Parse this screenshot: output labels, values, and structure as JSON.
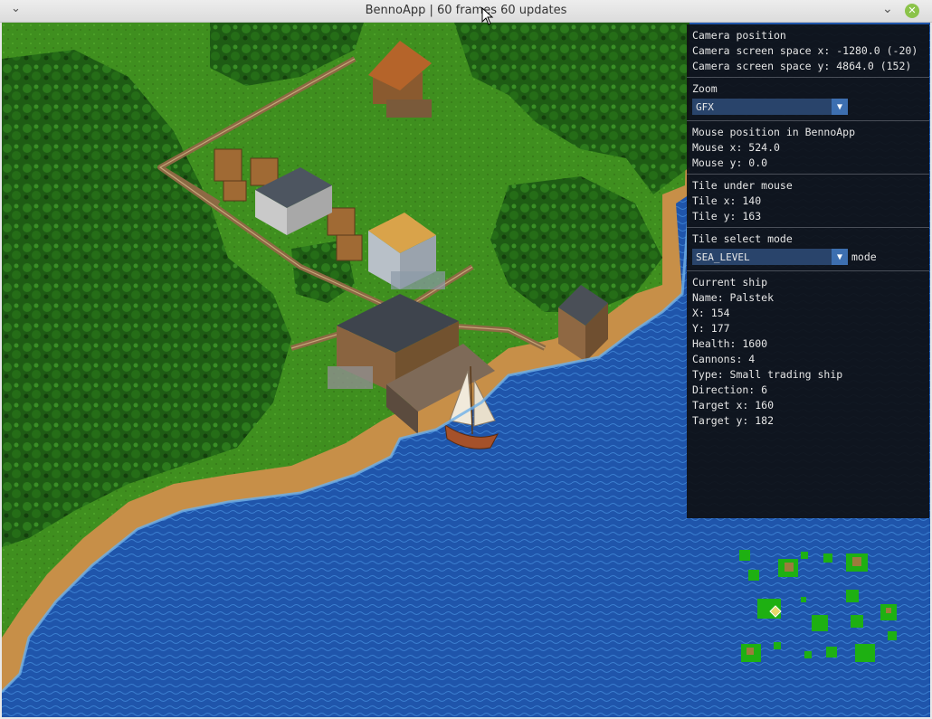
{
  "window": {
    "title": "BennoApp  |  60 frames  60 updates",
    "menu_icon": "chevron-down-icon",
    "minimize_icon": "minimize-icon",
    "close_icon": "close-icon"
  },
  "panel": {
    "camera": {
      "heading": "Camera position",
      "screen_x": "Camera screen space x: -1280.0 (-20)",
      "screen_y": "Camera screen space y: 4864.0 (152)"
    },
    "zoom": {
      "heading": "Zoom",
      "selected": "GFX"
    },
    "mouse": {
      "heading": "Mouse position in BennoApp",
      "x": "Mouse x: 524.0",
      "y": "Mouse y: 0.0"
    },
    "tile": {
      "heading": "Tile under mouse",
      "x": "Tile x: 140",
      "y": "Tile y: 163"
    },
    "select_mode": {
      "heading": "Tile select mode",
      "selected": "SEA_LEVEL",
      "suffix": "mode"
    },
    "ship": {
      "heading": "Current ship",
      "name": "Name: Palstek",
      "x": "X: 154",
      "y": "Y: 177",
      "health": "Health: 1600",
      "cannons": "Cannons: 4",
      "type": "Type: Small trading ship",
      "direction": "Direction: 6",
      "target_x": "Target x: 160",
      "target_y": "Target y: 182"
    }
  },
  "colors": {
    "grass": "#3f8f1f",
    "forest": "#1d5a12",
    "sand": "#c78f48",
    "shallow_water": "#2f74c8",
    "deep_water": "#1a4a9e",
    "panel_bg": "#0e1014",
    "combo_bg": "#29446b",
    "combo_arrow": "#3d6fb0"
  }
}
